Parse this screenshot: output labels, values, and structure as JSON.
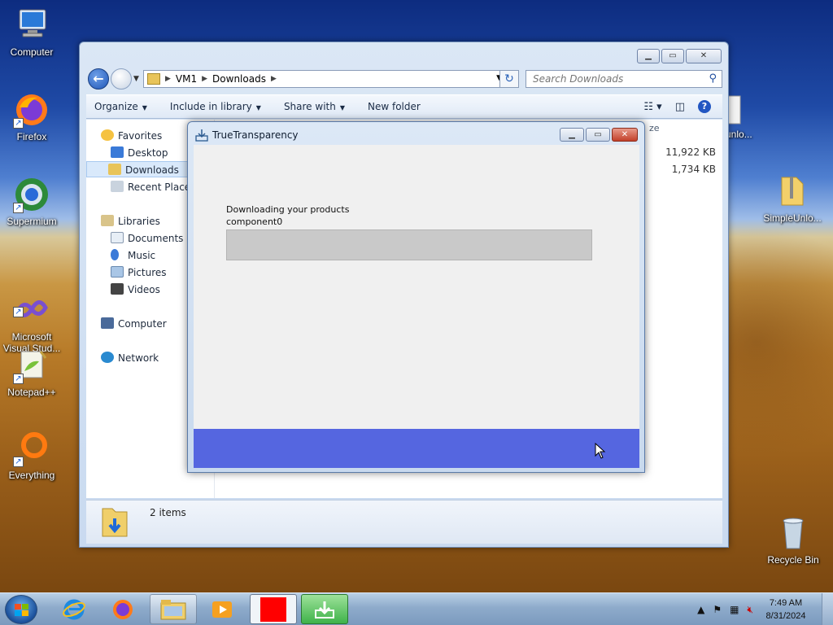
{
  "desktop": {
    "icons": [
      {
        "label": "Computer"
      },
      {
        "label": "Firefox"
      },
      {
        "label": "Supermium"
      },
      {
        "label": "Microsoft\nVisual Stud..."
      },
      {
        "label": "Notepad++"
      },
      {
        "label": "Everything"
      },
      {
        "label": "SimpleUnlo..."
      },
      {
        "label": "Recycle Bin"
      },
      {
        "label": "unlo..."
      }
    ]
  },
  "explorer": {
    "path": [
      "VM1",
      "Downloads"
    ],
    "search_placeholder": "Search Downloads",
    "toolbar": {
      "organize": "Organize",
      "include_in_library": "Include in library",
      "share_with": "Share with",
      "new_folder": "New folder"
    },
    "nav": {
      "favorites": "Favorites",
      "desktop": "Desktop",
      "downloads": "Downloads",
      "recent_places": "Recent Places",
      "libraries": "Libraries",
      "documents": "Documents",
      "music": "Music",
      "pictures": "Pictures",
      "videos": "Videos",
      "computer": "Computer",
      "network": "Network"
    },
    "column_partial": "ze",
    "files": [
      {
        "size": "11,922 KB"
      },
      {
        "size": "1,734 KB"
      }
    ],
    "details": {
      "count": "2 items"
    }
  },
  "dialog": {
    "title": "TrueTransparency",
    "status": "Downloading your products",
    "component": "component0",
    "progress_fraction": 0,
    "footer_color": "#5566e0"
  },
  "taskbar": {
    "time": "7:49 AM",
    "date": "8/31/2024"
  },
  "colors": {
    "progress_fill": "#3cb44a",
    "selection": "#d9e9fb"
  }
}
